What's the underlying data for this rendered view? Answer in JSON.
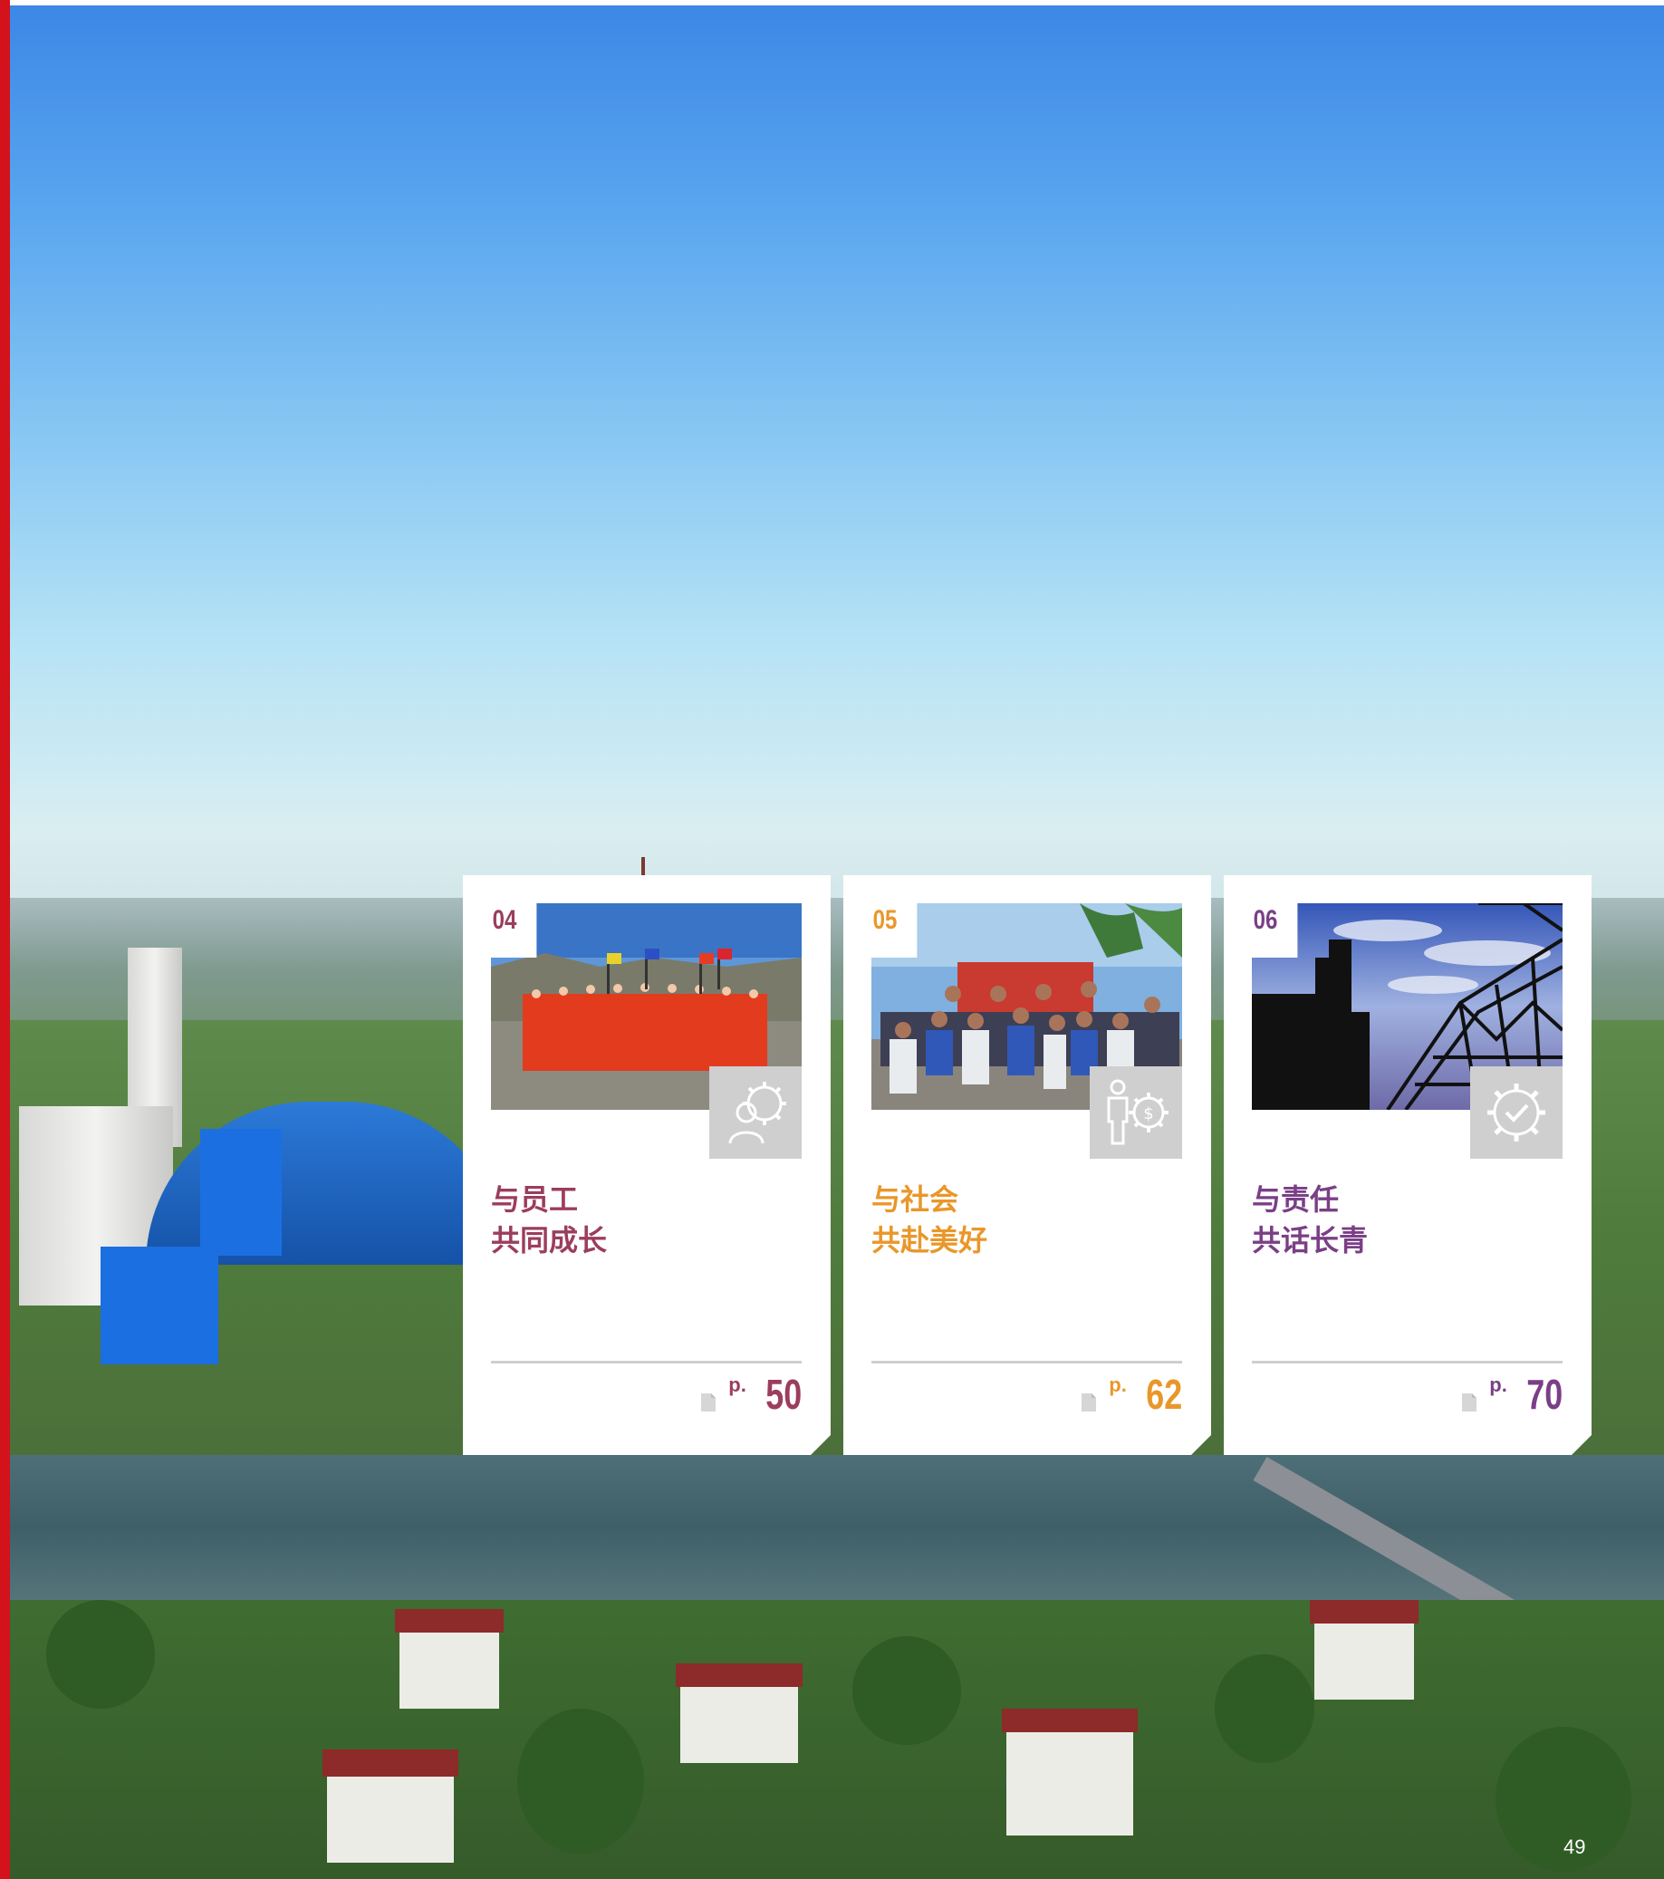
{
  "page": {
    "number": "49"
  },
  "cards": [
    {
      "index": "04",
      "title_line1": "与员工",
      "title_line2": "共同成长",
      "page_prefix": "p.",
      "page": "50",
      "color": "#9b3d5e",
      "icon": "employee-gear-icon"
    },
    {
      "index": "05",
      "title_line1": "与社会",
      "title_line2": "共赴美好",
      "page_prefix": "p.",
      "page": "62",
      "color": "#e9972a",
      "icon": "person-money-gear-icon"
    },
    {
      "index": "06",
      "title_line1": "与责任",
      "title_line2": "共话长青",
      "page_prefix": "p.",
      "page": "70",
      "color": "#7a3f86",
      "icon": "gear-check-icon"
    }
  ],
  "colors": {
    "accent_red": "#d3121c"
  }
}
